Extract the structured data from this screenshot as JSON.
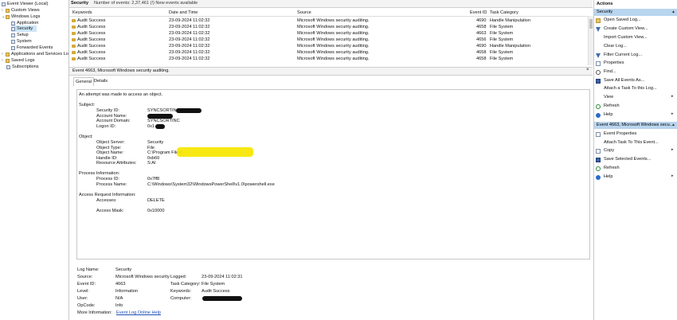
{
  "tree": {
    "items": [
      {
        "label": "Event Viewer (Local)"
      },
      {
        "label": "Custom Views"
      },
      {
        "label": "Windows Logs"
      },
      {
        "label": "Application"
      },
      {
        "label": "Security"
      },
      {
        "label": "Setup"
      },
      {
        "label": "System"
      },
      {
        "label": "Forwarded Events"
      },
      {
        "label": "Applications and Services Lo"
      },
      {
        "label": "Saved Logs"
      },
      {
        "label": "Subscriptions"
      }
    ]
  },
  "list": {
    "title": "Security",
    "count": "Number of events: 2,37,461 (!) New events available",
    "columns": [
      "Keywords",
      "Date and Time",
      "Source",
      "Event ID",
      "Task Category"
    ],
    "rows": [
      [
        "Audit Success",
        "23-09-2024 11:02:32",
        "Microsoft Windows security auditing.",
        "4690",
        "Handle Manipulation"
      ],
      [
        "Audit Success",
        "23-09-2024 11:02:32",
        "Microsoft Windows security auditing.",
        "4658",
        "File System"
      ],
      [
        "Audit Success",
        "23-09-2024 11:02:32",
        "Microsoft Windows security auditing.",
        "4663",
        "File System"
      ],
      [
        "Audit Success",
        "23-09-2024 11:02:32",
        "Microsoft Windows security auditing.",
        "4656",
        "File System"
      ],
      [
        "Audit Success",
        "23-09-2024 11:02:32",
        "Microsoft Windows security auditing.",
        "4690",
        "Handle Manipulation"
      ],
      [
        "Audit Success",
        "23-09-2024 11:02:32",
        "Microsoft Windows security auditing.",
        "4658",
        "File System"
      ],
      [
        "Audit Success",
        "23-09-2024 11:02:32",
        "Microsoft Windows security auditing.",
        "4658",
        "File System"
      ]
    ]
  },
  "event": {
    "title": "Event 4663, Microsoft Windows security auditing.",
    "close": "×",
    "tabs": [
      "General",
      "Details"
    ],
    "message": {
      "intro": "An attempt was made to access an object.",
      "subject": "Subject:",
      "security_id_label": "Security ID:",
      "security_id_value": "SYNCSORTINC\\",
      "account_name_label": "Account Name:",
      "account_domain_label": "Account Domain:",
      "account_domain_value": "SYNCSORTINC",
      "logon_id_label": "Logon ID:",
      "logon_id_value": "0x1",
      "object": "Object:",
      "object_server_label": "Object Server:",
      "object_server_value": "Security",
      "object_type_label": "Object Type:",
      "object_type_value": "File",
      "object_name_label": "Object Name:",
      "object_name_value": "C:\\Program Files\\",
      "handle_id_label": "Handle ID:",
      "handle_id_value": "0xb60",
      "resource_label": "Resource Attributes:",
      "resource_value": "S:AI",
      "process_info": "Process Information:",
      "process_id_label": "Process ID:",
      "process_id_value": "0x7ff8",
      "process_name_label": "Process Name:",
      "process_name_value": "C:\\Windows\\System32\\WindowsPowerShell\\v1.0\\powershell.exe",
      "access_request": "Access Request Information:",
      "accesses_label": "Accesses:",
      "accesses_value": "DELETE",
      "access_mask_label": "Access Mask:",
      "access_mask_value": "0x10000"
    },
    "fields": {
      "log_name_label": "Log Name:",
      "log_name_value": "Security",
      "source_label": "Source:",
      "source_value": "Microsoft Windows security",
      "logged_label": "Logged:",
      "logged_value": "23-09-2024 11:02:31",
      "event_id_label": "Event ID:",
      "event_id_value": "4663",
      "task_category_label": "Task Category:",
      "task_category_value": "File System",
      "level_label": "Level:",
      "level_value": "Information",
      "keywords_label": "Keywords:",
      "keywords_value": "Audit Success",
      "user_label": "User:",
      "user_value": "N/A",
      "computer_label": "Computer:",
      "opcode_label": "OpCode:",
      "opcode_value": "Info",
      "more_info_label": "More Information:",
      "more_info_link": "Event Log Online Help"
    }
  },
  "actions": {
    "header": "Actions",
    "section1": "Security",
    "section1_items": [
      {
        "label": "Open Saved Log...",
        "icon": "folder-icon"
      },
      {
        "label": "Create Custom View...",
        "icon": "filter-icon"
      },
      {
        "label": "Import Custom View...",
        "icon": "import-icon"
      },
      {
        "label": "Clear Log...",
        "icon": "clear-icon"
      },
      {
        "label": "Filter Current Log...",
        "icon": "filter-icon"
      },
      {
        "label": "Properties",
        "icon": "properties-icon"
      },
      {
        "label": "Find...",
        "icon": "find-icon"
      },
      {
        "label": "Save All Events As...",
        "icon": "save-icon"
      },
      {
        "label": "Attach a Task To this Log...",
        "icon": "task-icon"
      },
      {
        "label": "View",
        "icon": "view-icon"
      },
      {
        "label": "Refresh",
        "icon": "refresh-icon"
      },
      {
        "label": "Help",
        "icon": "help-icon"
      }
    ],
    "section2": "Event 4663, Microsoft Windows secu...",
    "section2_items": [
      {
        "label": "Event Properties",
        "icon": "properties-icon"
      },
      {
        "label": "Attach Task To This Event...",
        "icon": "task-icon"
      },
      {
        "label": "Copy",
        "icon": "copy-icon"
      },
      {
        "label": "Save Selected Events...",
        "icon": "save-icon"
      },
      {
        "label": "Refresh",
        "icon": "refresh-icon"
      },
      {
        "label": "Help",
        "icon": "help-icon"
      }
    ],
    "arrow": "▸",
    "collapse": "▲"
  }
}
